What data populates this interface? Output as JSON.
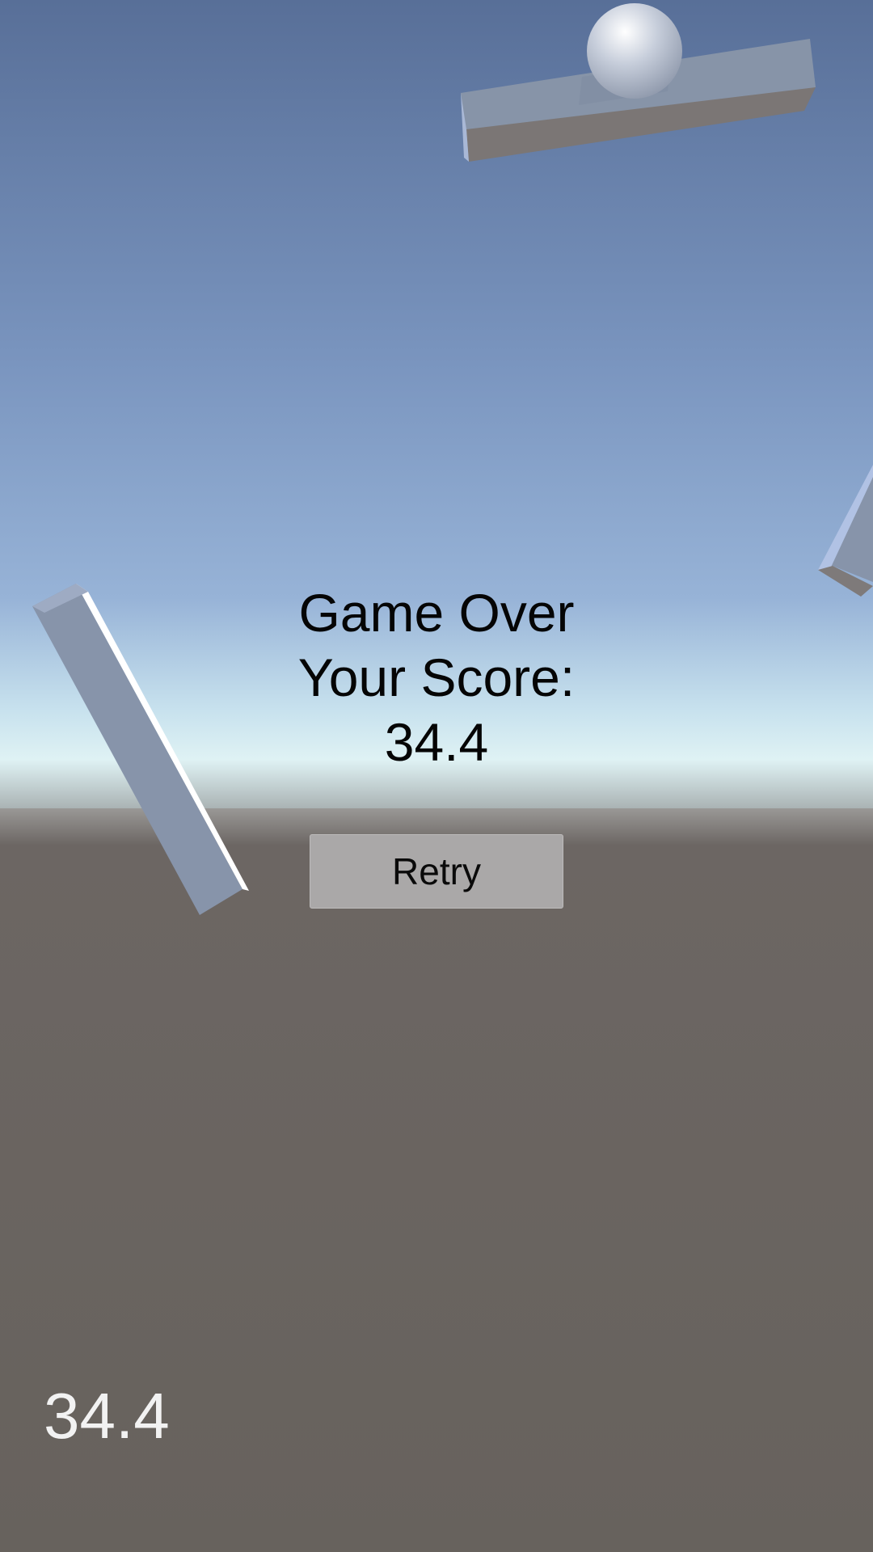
{
  "game_over": {
    "title": "Game Over",
    "score_label": "Your Score:",
    "score_value": "34.4"
  },
  "retry_button": {
    "label": "Retry"
  },
  "hud": {
    "score": "34.4"
  },
  "colors": {
    "sky_top": "#5a7399",
    "sky_horizon": "#d7eef2",
    "ground": "#68625e",
    "beam_face": "#8a97aa",
    "beam_shadow": "#7a7575",
    "button": "#aaa8a8"
  }
}
